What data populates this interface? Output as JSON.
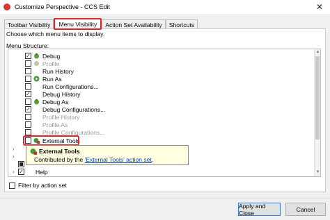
{
  "window": {
    "title": "Customize Perspective - CCS Edit",
    "close_symbol": "✕",
    "brand_color": "#d9372f"
  },
  "tabs": [
    {
      "label": "Toolbar Visibility",
      "active": false
    },
    {
      "label": "Menu Visibility",
      "active": true
    },
    {
      "label": "Action Set Availability",
      "active": false
    },
    {
      "label": "Shortcuts",
      "active": false
    }
  ],
  "panel": {
    "description": "Choose which menu items to display.",
    "menu_structure_label": "Menu Structure:"
  },
  "tree": {
    "items": [
      {
        "label": "Debug",
        "checked": true,
        "enabled": true,
        "icon": "debug-icon"
      },
      {
        "label": "Profile",
        "checked": false,
        "enabled": false,
        "icon": "profile-icon"
      },
      {
        "label": "Run History",
        "checked": false,
        "enabled": true,
        "icon": ""
      },
      {
        "label": "Run As",
        "checked": false,
        "enabled": true,
        "icon": "run-icon"
      },
      {
        "label": "Run Configurations...",
        "checked": false,
        "enabled": true,
        "icon": ""
      },
      {
        "label": "Debug History",
        "checked": true,
        "enabled": true,
        "icon": ""
      },
      {
        "label": "Debug As",
        "checked": false,
        "enabled": true,
        "icon": "debug-icon"
      },
      {
        "label": "Debug Configurations...",
        "checked": true,
        "enabled": true,
        "icon": ""
      },
      {
        "label": "Profile History",
        "checked": false,
        "enabled": false,
        "icon": ""
      },
      {
        "label": "Profile As",
        "checked": false,
        "enabled": false,
        "icon": ""
      },
      {
        "label": "Profile Configurations...",
        "checked": false,
        "enabled": false,
        "icon": ""
      },
      {
        "label": "External Tools",
        "checked": false,
        "enabled": true,
        "icon": "external-tools-icon"
      }
    ],
    "help_label": "Help"
  },
  "tooltip": {
    "title": "External Tools",
    "body_prefix": "Contributed by the ",
    "link": "'External Tools' action set",
    "body_suffix": "."
  },
  "filter": {
    "label": "Filter by action set"
  },
  "buttons": {
    "apply_close": "Apply and Close",
    "cancel": "Cancel"
  },
  "colors": {
    "highlight": "#e0222a",
    "tooltip_bg": "#ffffe1",
    "link": "#0645c8",
    "default_button_border": "#2f7cd6"
  }
}
